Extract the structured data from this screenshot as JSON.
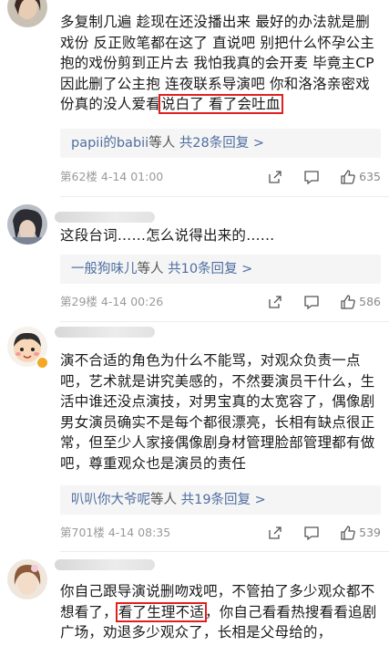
{
  "comments": [
    {
      "text_before": "多复制几遍 趁现在还没播出来 最好的办法就是删戏份 反正败笔都在这了 直说吧 别把什么怀孕公主抱的戏份剪到正片去 我怕我真的会开麦 毕竟主CP因此删了公主抱 连夜联系导演吧 你和洛洛亲密戏份真的没人爱看",
      "highlight": "说白了 看了会吐血",
      "text_after": "",
      "reply_user": "papii的babii",
      "reply_etal": "等人",
      "reply_count": "共28条回复 >",
      "floor_time": "第62楼 4-14 01:00",
      "likes": "635"
    },
    {
      "text_before": "这段台词……怎么说得出来的……",
      "highlight": "",
      "text_after": "",
      "reply_user": "一般狗味儿",
      "reply_etal": "等人",
      "reply_count": "共10条回复 >",
      "floor_time": "第29楼 4-14 00:26",
      "likes": "586"
    },
    {
      "text_before": "演不合适的角色为什么不能骂，对观众负责一点吧，艺术就是讲究美感的，不然要演员干什么，生活中谁还没点演技，对男宝真的太宽容了，偶像剧男女演员确实不是每个都很漂亮，长相有缺点很正常，但至少人家接偶像剧身材管理脸部管理都有做吧，尊重观众也是演员的责任",
      "highlight": "",
      "text_after": "",
      "reply_user": "叭叭你大爷呢",
      "reply_etal": "等人",
      "reply_count": "共19条回复 >",
      "floor_time": "第701楼 4-14 08:35",
      "likes": "539"
    },
    {
      "text_before": "你自己跟导演说删吻戏吧，不管拍了多少观众都不想看了，",
      "highlight": "看了生理不适",
      "text_after": "，你自己看看热搜看看追剧广场，劝退多少观众了，长相是父母给的，",
      "reply_user": "",
      "reply_etal": "",
      "reply_count": "",
      "floor_time": "",
      "likes": ""
    }
  ],
  "icons": {
    "share": "share-icon",
    "comment": "comment-icon",
    "like": "thumbs-up-icon"
  },
  "colors": {
    "link": "#4e6ea0",
    "highlight_border": "#e02020",
    "reply_bg": "#f5f5f5",
    "meta": "#9a9a9a"
  }
}
